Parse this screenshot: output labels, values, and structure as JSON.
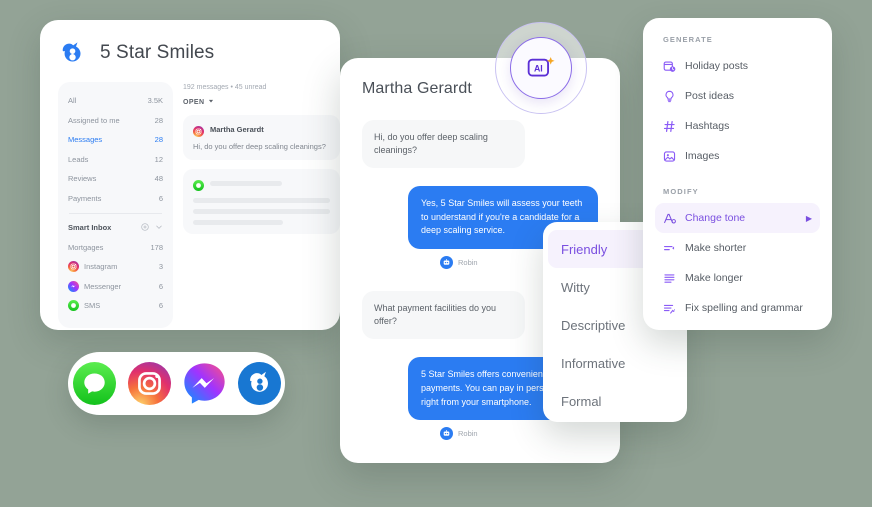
{
  "brand": {
    "name": "5 Star Smiles",
    "logo_icon": "birdeye-bird-logo"
  },
  "inbox": {
    "folders": [
      {
        "label": "All",
        "count": "3.5K",
        "active": false
      },
      {
        "label": "Assigned to me",
        "count": "28",
        "active": false
      },
      {
        "label": "Messages",
        "count": "28",
        "active": true
      },
      {
        "label": "Leads",
        "count": "12",
        "active": false
      },
      {
        "label": "Reviews",
        "count": "48",
        "active": false
      },
      {
        "label": "Payments",
        "count": "6",
        "active": false
      }
    ],
    "smart_inbox": {
      "label": "Smart Inbox",
      "add_icon": "plus-circle-icon",
      "chevron_icon": "chevron-down-icon"
    },
    "channels": [
      {
        "label": "Mortgages",
        "count": "178",
        "icon": "none"
      },
      {
        "label": "Instagram",
        "count": "3",
        "icon": "instagram-icon"
      },
      {
        "label": "Messenger",
        "count": "6",
        "icon": "messenger-icon"
      },
      {
        "label": "SMS",
        "count": "6",
        "icon": "sms-icon"
      }
    ],
    "list": {
      "meta": "192 messages • 45 unread",
      "filter_label": "OPEN",
      "filter_icon": "caret-down-icon",
      "conversations": [
        {
          "name": "Martha Gerardt",
          "avatar_icon": "instagram-icon",
          "preview": "Hi, do you offer deep scaling cleanings?"
        }
      ],
      "skeleton_avatar_icon": "sms-icon"
    }
  },
  "social_pill": {
    "icons": [
      "sms-icon",
      "instagram-icon",
      "messenger-icon",
      "birdeye-icon"
    ]
  },
  "chat": {
    "title": "Martha Gerardt",
    "ai_badge": {
      "label": "AI",
      "icon": "ai-sparkle-icon"
    },
    "messages": [
      {
        "direction": "in",
        "text": "Hi, do you offer deep scaling cleanings?"
      },
      {
        "direction": "out",
        "text": "Yes, 5 Star Smiles will assess your teeth to understand if you're a candidate for a deep scaling service.",
        "sender": "Robin",
        "sender_avatar_icon": "robot-icon"
      },
      {
        "direction": "in",
        "text": "What payment facilities do you offer?"
      },
      {
        "direction": "out",
        "text": "5 Star Smiles offers convenient online payments. You can pay in person or pay right from your smartphone.",
        "sender": "Robin",
        "sender_avatar_icon": "robot-icon"
      }
    ]
  },
  "tone_menu": {
    "options": [
      {
        "label": "Friendly",
        "selected": true
      },
      {
        "label": "Witty",
        "selected": false
      },
      {
        "label": "Descriptive",
        "selected": false
      },
      {
        "label": "Informative",
        "selected": false
      },
      {
        "label": "Formal",
        "selected": false
      }
    ]
  },
  "ai_menu": {
    "generate_heading": "GENERATE",
    "generate_items": [
      {
        "label": "Holiday posts",
        "icon": "holiday-posts-icon"
      },
      {
        "label": "Post ideas",
        "icon": "lightbulb-icon"
      },
      {
        "label": "Hashtags",
        "icon": "hashtag-icon"
      },
      {
        "label": "Images",
        "icon": "image-icon"
      }
    ],
    "modify_heading": "MODIFY",
    "modify_items": [
      {
        "label": "Change tone",
        "icon": "change-tone-icon",
        "selected": true,
        "arrow": "▶"
      },
      {
        "label": "Make shorter",
        "icon": "make-shorter-icon",
        "selected": false,
        "arrow": ""
      },
      {
        "label": "Make longer",
        "icon": "make-longer-icon",
        "selected": false,
        "arrow": ""
      },
      {
        "label": "Fix spelling and grammar",
        "icon": "spellcheck-icon",
        "selected": false,
        "arrow": ""
      }
    ]
  },
  "colors": {
    "page_background": "#93a396",
    "brand_blue": "#2b7cf2",
    "accent_purple": "#7a4fe0",
    "card_white": "#ffffff",
    "muted_text": "#8d949e"
  }
}
